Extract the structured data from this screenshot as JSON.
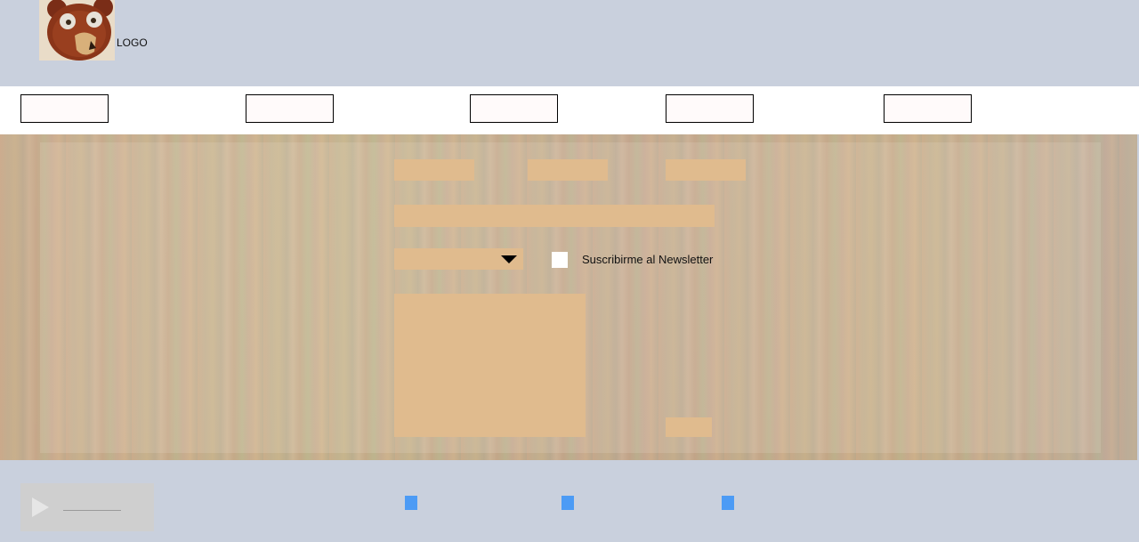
{
  "header": {
    "logo_text": "LOGO",
    "logo_icon": "bear-mascot-icon"
  },
  "nav": {
    "items": [
      {
        "label": ""
      },
      {
        "label": ""
      },
      {
        "label": ""
      },
      {
        "label": ""
      },
      {
        "label": ""
      }
    ]
  },
  "form": {
    "fields": [
      {
        "value": "",
        "placeholder": ""
      },
      {
        "value": "",
        "placeholder": ""
      },
      {
        "value": "",
        "placeholder": ""
      },
      {
        "value": "",
        "placeholder": ""
      }
    ],
    "dropdown": {
      "selected": "",
      "icon": "caret-down-icon"
    },
    "newsletter": {
      "label": "Suscribirme al Newsletter",
      "checked": false
    },
    "message": {
      "value": "",
      "placeholder": ""
    },
    "submit_label": ""
  },
  "footer": {
    "player": {
      "icon": "play-icon"
    },
    "dots_color": "#4c9bf5",
    "dots": [
      {
        "label": ""
      },
      {
        "label": ""
      },
      {
        "label": ""
      }
    ]
  },
  "colors": {
    "background": "#c9d0dd",
    "field": "#e0bb8e",
    "nav_bg": "#ffffff"
  }
}
